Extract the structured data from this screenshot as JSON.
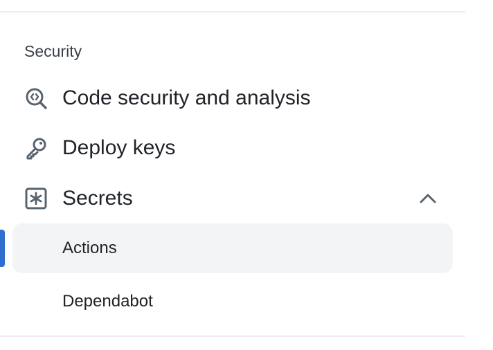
{
  "sidebar": {
    "section_heading": "Security",
    "items": [
      {
        "label": "Code security and analysis",
        "icon": "codescan-icon"
      },
      {
        "label": "Deploy keys",
        "icon": "key-icon"
      },
      {
        "label": "Secrets",
        "icon": "asterisk-box-icon",
        "expanded": true
      }
    ],
    "secrets_children": [
      {
        "label": "Actions",
        "selected": true
      },
      {
        "label": "Dependabot",
        "selected": false
      }
    ],
    "accent_color": "#2f6fcd",
    "selected_bg": "#f3f4f6"
  }
}
